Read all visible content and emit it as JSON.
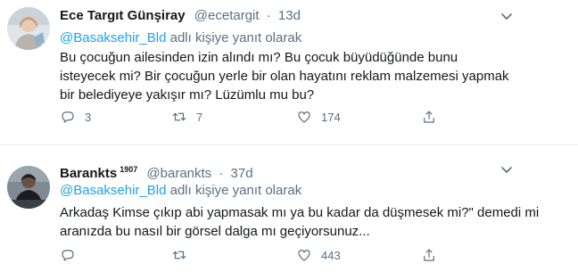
{
  "tweets": [
    {
      "name": "Ece Targıt Günşiray",
      "badge": "",
      "handle": "@ecetargit",
      "separator": "·",
      "time": "13d",
      "replying_mention": "@Basaksehir_Bld",
      "replying_suffix": "adlı kişiye yanıt olarak",
      "text": "Bu çocuğun ailesinden izin alındı mı? Bu çocuk büyüdüğünde bunu isteyecek mi? Bir çocuğun yerle bir olan hayatını reklam malzemesi yapmak bir belediyeye yakışır mı? Lüzümlu mu bu?",
      "replies": "3",
      "retweets": "7",
      "likes": "174"
    },
    {
      "name": "Barankts",
      "badge": "1907",
      "handle": "@barankts",
      "separator": "·",
      "time": "37d",
      "replying_mention": "@Basaksehir_Bld",
      "replying_suffix": "adlı kişiye yanıt olarak",
      "text": "Arkadaş Kimse çıkıp abi yapmasak mı ya bu kadar da düşmesek mi?\" demedi mi aranızda bu nasıl bir görsel dalga mı geçiyorsunuz...",
      "replies": "",
      "retweets": "",
      "likes": "443"
    }
  ],
  "icons": {
    "caret": "chevron-down-icon",
    "reply": "reply-icon",
    "retweet": "retweet-icon",
    "like": "heart-icon",
    "share": "share-icon"
  },
  "colors": {
    "link": "#1da1f2",
    "muted": "#5b7083",
    "text": "#14171a",
    "divider": "#e6ecf0"
  }
}
